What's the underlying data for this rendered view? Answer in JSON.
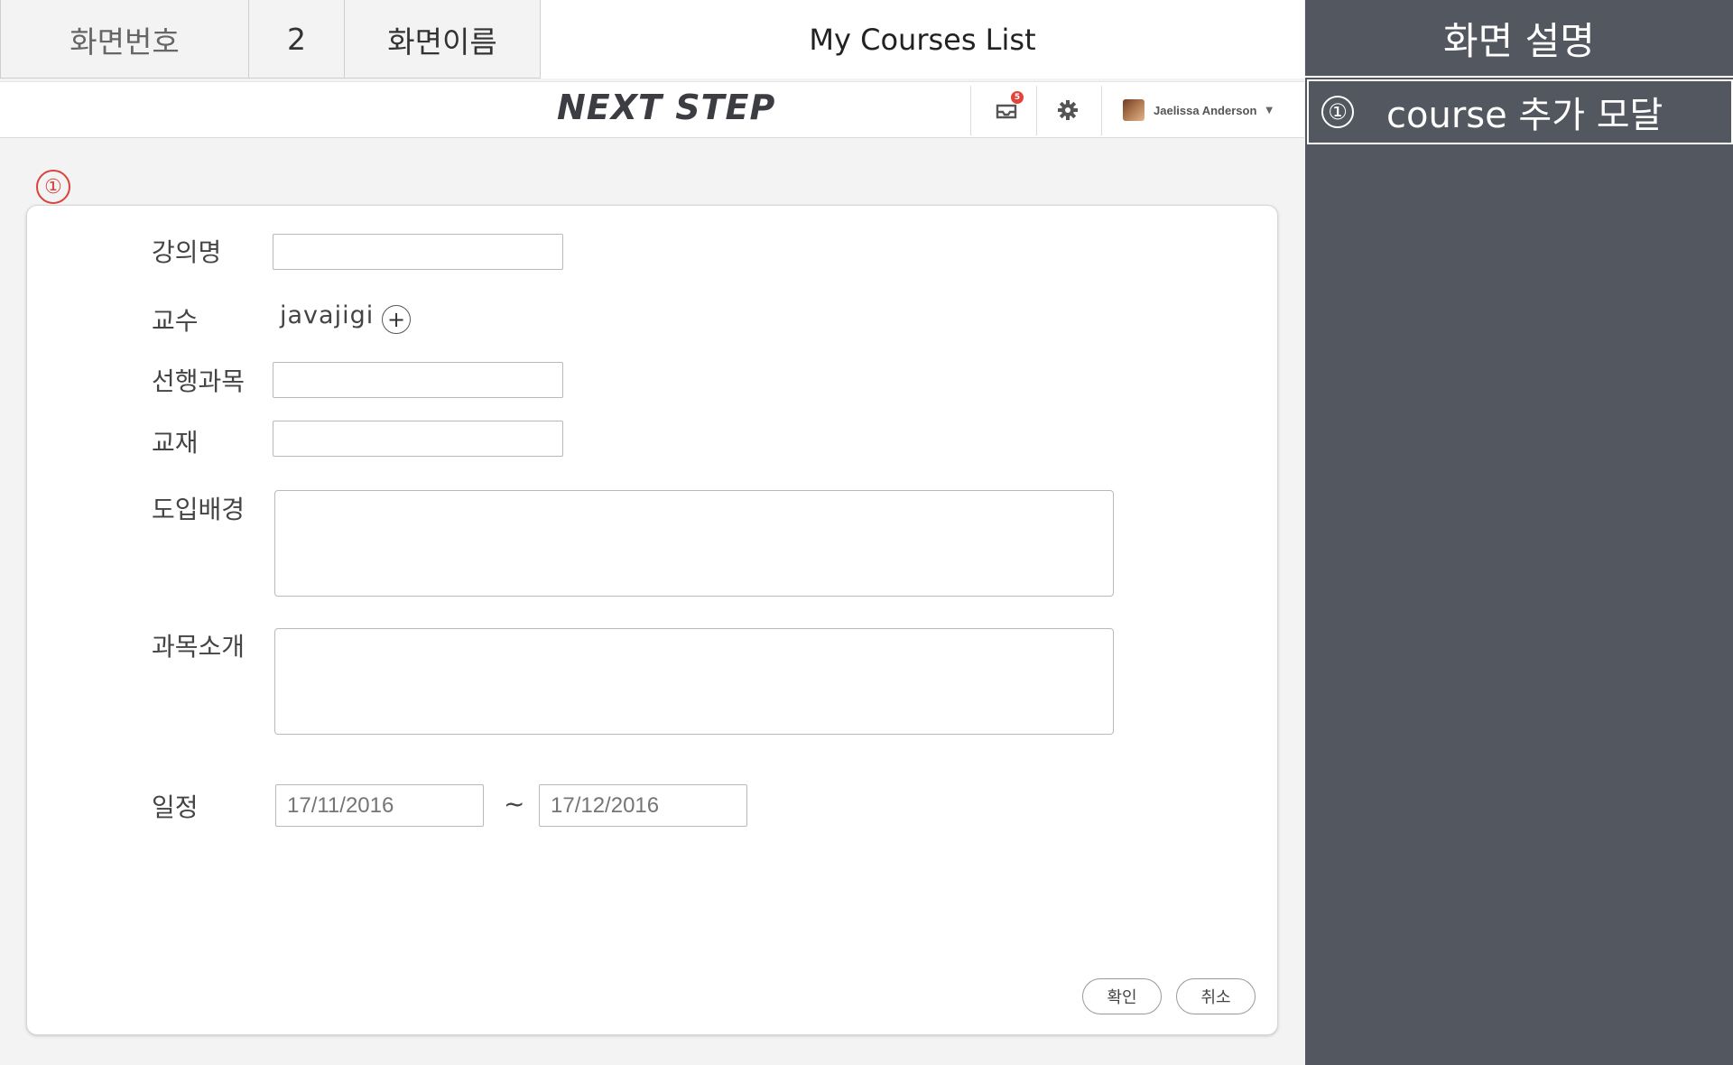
{
  "info_header": {
    "screen_no_label": "화면번호",
    "screen_no": "2",
    "screen_name_label": "화면이름",
    "screen_name": "My Courses List"
  },
  "description_panel": {
    "title": "화면 설명",
    "items": [
      {
        "num": "①",
        "text": "course 추가 모달"
      }
    ]
  },
  "navbar": {
    "logo": "NEXT STEP",
    "notification_count": "5",
    "user_name": "Jaelissa Anderson",
    "icons": [
      "notification-icon",
      "gear-icon",
      "avatar",
      "caret-down-icon"
    ]
  },
  "modal": {
    "marker": "①",
    "fields": {
      "course_name_label": "강의명",
      "course_name_value": "",
      "professor_label": "교수",
      "professor_value": "javajigi",
      "add_professor": "+",
      "prerequisite_label": "선행과목",
      "prerequisite_value": "",
      "textbook_label": "교재",
      "textbook_value": "",
      "background_label": "도입배경",
      "background_value": "",
      "intro_label": "과목소개",
      "intro_value": "",
      "schedule_label": "일정",
      "start_placeholder": "17/11/2016",
      "tilde": "~",
      "end_placeholder": "17/12/2016"
    },
    "buttons": {
      "confirm": "확인",
      "cancel": "취소"
    }
  },
  "colors": {
    "panel_bg": "#535760",
    "marker_red": "#d9433b",
    "badge_red": "#e0443a",
    "page_bg": "#f3f3f4"
  }
}
